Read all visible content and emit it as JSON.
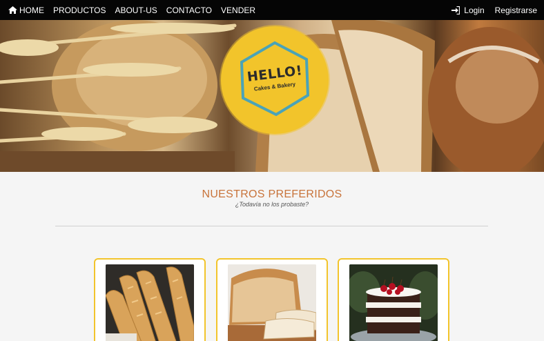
{
  "nav": {
    "home": "HOME",
    "products": "PRODUCTOS",
    "about": "ABOUT-US",
    "contact": "CONTACTO",
    "sell": "VENDER",
    "login": "Login",
    "register": "Registrarse"
  },
  "hero": {
    "logo_title": "HELLO!",
    "logo_subtitle": "Cakes & Bakery"
  },
  "section": {
    "title": "NUESTROS PREFERIDOS",
    "subtitle": "¿Todavía no los probaste?"
  },
  "products": [
    {
      "image": "baguettes"
    },
    {
      "image": "sliced-bread-loaf"
    },
    {
      "image": "layer-cake-with-cherries"
    }
  ],
  "colors": {
    "navbar": "#050505",
    "accent": "#f2c42b",
    "title": "#c8733a",
    "background": "#f5f5f5"
  }
}
